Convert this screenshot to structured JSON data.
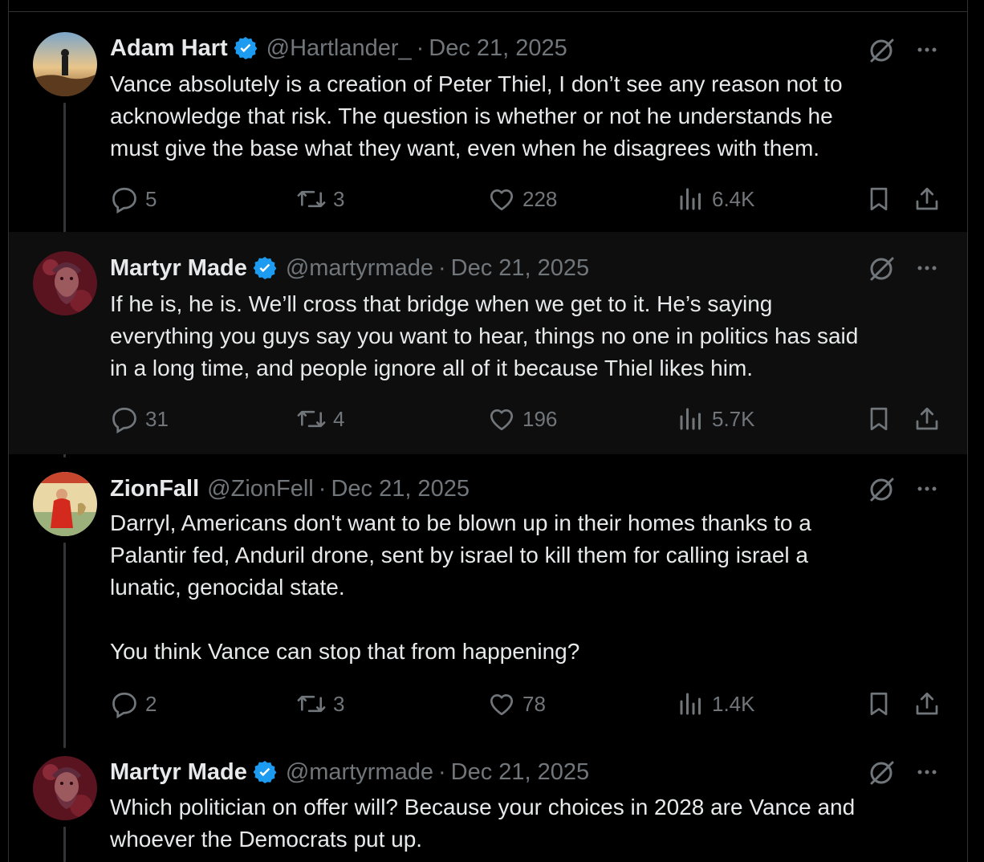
{
  "tweets": [
    {
      "name": "Adam Hart",
      "verified": true,
      "handle": "@Hartlander_",
      "sep": "·",
      "date": "Dec 21, 2025",
      "text": "Vance absolutely is a creation of Peter Thiel, I don’t see any reason not to\nacknowledge that risk. The question is whether or not he understands he\nmust give the base what they want, even when he disagrees with them.",
      "replies": "5",
      "reposts": "3",
      "likes": "228",
      "views": "6.4K",
      "avatar_icon": "landscape-avatar",
      "highlighted": false
    },
    {
      "name": "Martyr Made",
      "verified": true,
      "handle": "@martyrmade",
      "sep": "·",
      "date": "Dec 21, 2025",
      "text": "If he is, he is. We’ll cross that bridge when we get to it. He’s saying\neverything you guys say you want to hear, things no one in politics has said\nin a long time, and people ignore all of it because Thiel likes him.",
      "replies": "31",
      "reposts": "4",
      "likes": "196",
      "views": "5.7K",
      "avatar_icon": "statue-avatar",
      "highlighted": true
    },
    {
      "name": "ZionFall",
      "verified": false,
      "handle": "@ZionFell",
      "sep": "·",
      "date": "Dec 21, 2025",
      "text": "Darryl, Americans don't want to be blown up in their homes thanks to a\nPalantir fed, Anduril drone, sent by israel to kill them for calling israel a\nlunatic, genocidal state.\n\nYou think Vance can stop that from happening?",
      "replies": "2",
      "reposts": "3",
      "likes": "78",
      "views": "1.4K",
      "avatar_icon": "painting-avatar",
      "highlighted": false
    },
    {
      "name": "Martyr Made",
      "verified": true,
      "handle": "@martyrmade",
      "sep": "·",
      "date": "Dec 21, 2025",
      "text": "Which politician on offer will? Because your choices in 2028 are Vance and\nwhoever the Democrats put up.",
      "avatar_icon": "statue-avatar",
      "highlighted": false
    }
  ],
  "colors": {
    "background": "#000000",
    "highlight_background": "#0e0e0e",
    "text": "#e7e9ea",
    "muted": "#71767b",
    "verified": "#1d9bf0",
    "thread_line": "#333639"
  },
  "icons": [
    "grok-icon",
    "more-icon",
    "reply-icon",
    "retweet-icon",
    "like-icon",
    "views-icon",
    "bookmark-icon",
    "share-icon",
    "verified-badge-icon"
  ]
}
